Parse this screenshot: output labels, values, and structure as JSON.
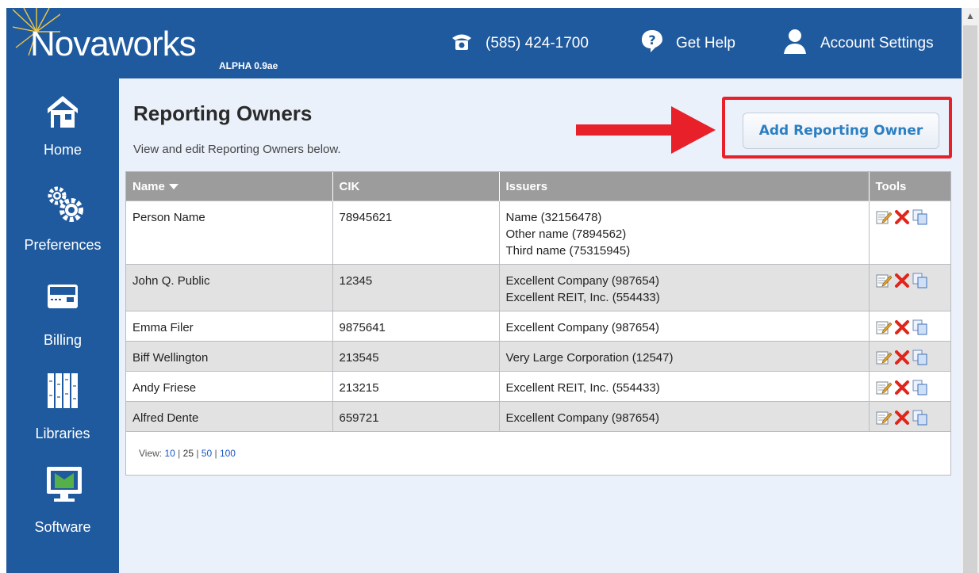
{
  "header": {
    "logo_text": "Novaworks",
    "version": "ALPHA 0.9ae",
    "phone": "(585) 424-1700",
    "help_label": "Get Help",
    "account_label": "Account Settings"
  },
  "sidebar": {
    "items": [
      {
        "label": "Home",
        "icon": "home-icon"
      },
      {
        "label": "Preferences",
        "icon": "gears-icon"
      },
      {
        "label": "Billing",
        "icon": "credit-card-icon"
      },
      {
        "label": "Libraries",
        "icon": "books-icon"
      },
      {
        "label": "Software",
        "icon": "monitor-icon"
      }
    ]
  },
  "page": {
    "title": "Reporting Owners",
    "subtitle": "View and edit Reporting Owners below.",
    "add_button": "Add Reporting Owner"
  },
  "table": {
    "columns": [
      "Name",
      "CIK",
      "Issuers",
      "Tools"
    ],
    "rows": [
      {
        "name": "Person Name",
        "cik": "78945621",
        "issuers": [
          "Name (32156478)",
          "Other name (7894562)",
          "Third name (75315945)"
        ]
      },
      {
        "name": "John Q. Public",
        "cik": "12345",
        "issuers": [
          "Excellent Company (987654)",
          "Excellent REIT, Inc. (554433)"
        ]
      },
      {
        "name": "Emma Filer",
        "cik": "9875641",
        "issuers": [
          "Excellent Company (987654)"
        ]
      },
      {
        "name": "Biff Wellington",
        "cik": "213545",
        "issuers": [
          "Very Large Corporation (12547)"
        ]
      },
      {
        "name": "Andy Friese",
        "cik": "213215",
        "issuers": [
          "Excellent REIT, Inc. (554433)"
        ]
      },
      {
        "name": "Alfred Dente",
        "cik": "659721",
        "issuers": [
          "Excellent Company (987654)"
        ]
      }
    ]
  },
  "pager": {
    "label": "View:",
    "options": [
      "10",
      "25",
      "50",
      "100"
    ],
    "selected": "25"
  },
  "colors": {
    "brand_blue": "#1f5a9e",
    "highlight_red": "#e8202a",
    "button_text": "#2b7fc2"
  }
}
